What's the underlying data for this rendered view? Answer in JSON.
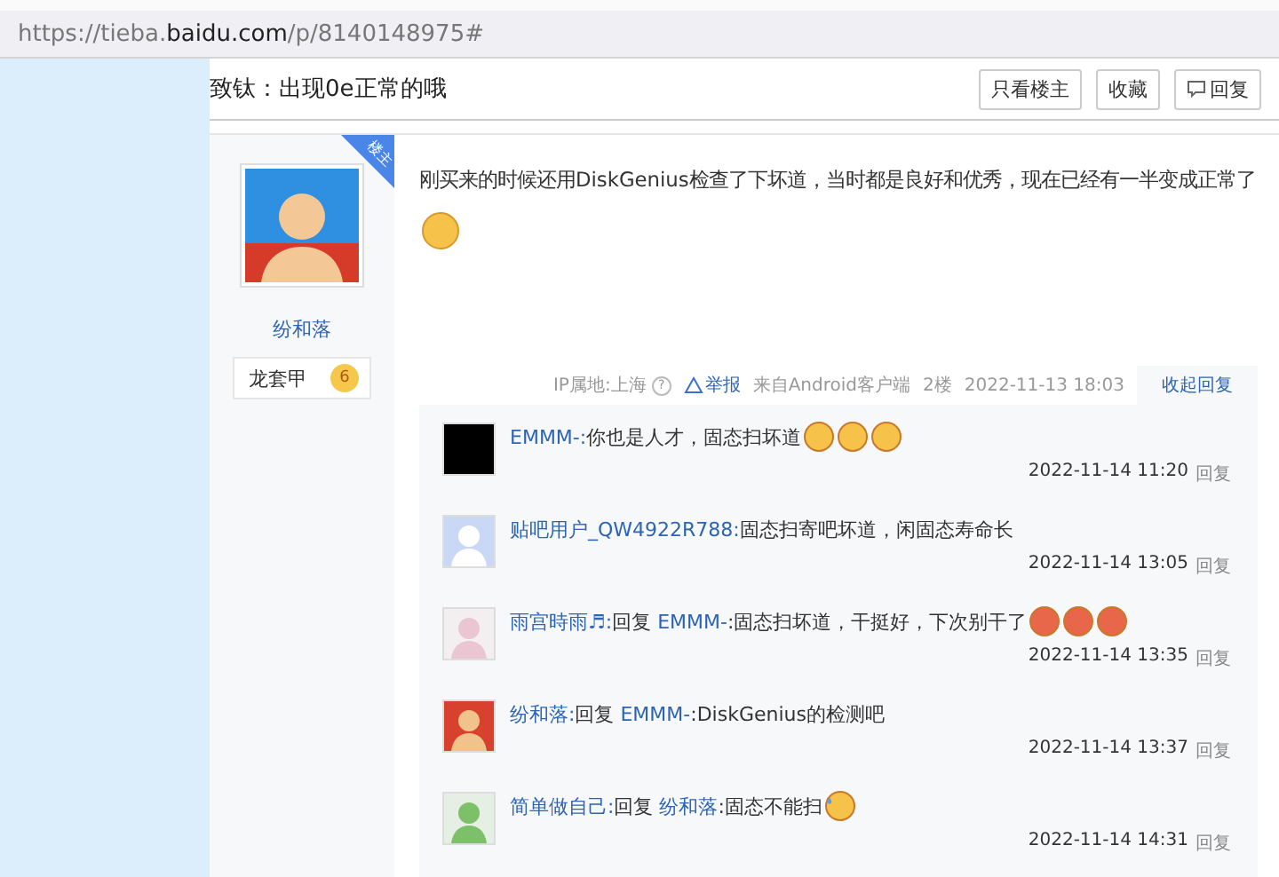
{
  "address_bar": {
    "url_prefix": "https://tieba.",
    "url_domain": "baidu.com",
    "url_path": "/p/8140148975#"
  },
  "thread": {
    "title": "致钛：出现0e正常的哦",
    "buttons": [
      {
        "label": "只看楼主",
        "kind": "plain"
      },
      {
        "label": "收藏",
        "kind": "plain"
      },
      {
        "label": "回复",
        "kind": "reply"
      }
    ]
  },
  "post": {
    "author": {
      "name": "纷和落",
      "badge": "楼主",
      "title": "龙套甲",
      "level": "6"
    },
    "content": {
      "text": "刚买来的时候还用DiskGenius检查了下坏道，当时都是良好和优秀，现在已经有一半变成正常了",
      "emoji": [
        {
          "kind": "smirk"
        }
      ]
    },
    "meta": {
      "ip": "IP属地:上海",
      "help": "?",
      "report": "举报",
      "source": "来自Android客户端",
      "floor": "2楼",
      "time": "2022-11-13 18:03",
      "collapse": "收起回复"
    },
    "replies": [
      {
        "avatar": {
          "kind": "black"
        },
        "user": "EMMM-:",
        "text": "你也是人才，固态扫坏道",
        "emoji": [
          {
            "kind": "smirk"
          },
          {
            "kind": "smirk"
          },
          {
            "kind": "smirk"
          }
        ],
        "time": "2022-11-14 11:20",
        "action": "回复"
      },
      {
        "avatar": {
          "kind": "default"
        },
        "user": "贴吧用户_QW4922R788:",
        "text": "固态扫寄吧坏道，闲固态寿命长",
        "time": "2022-11-14 13:05",
        "action": "回复"
      },
      {
        "avatar": {
          "kind": "pink"
        },
        "user": "雨宫時雨♬:",
        "reply_word": "回复",
        "reply_to": "EMMM-",
        "text": ":固态扫坏道，干挺好，下次别干了",
        "emoji": [
          {
            "kind": "red"
          },
          {
            "kind": "red"
          },
          {
            "kind": "red"
          }
        ],
        "time": "2022-11-14 13:35",
        "action": "回复"
      },
      {
        "avatar": {
          "kind": "red"
        },
        "user": "纷和落:",
        "reply_word": "回复",
        "reply_to": "EMMM-",
        "text": ":DiskGenius的检测吧",
        "time": "2022-11-14 13:37",
        "action": "回复"
      },
      {
        "avatar": {
          "kind": "green"
        },
        "user": "简单做自己:",
        "reply_word": "回复",
        "reply_to": "纷和落",
        "text": ":固态不能扫",
        "emoji": [
          {
            "kind": "sweat"
          }
        ],
        "time": "2022-11-14 14:31",
        "action": "回复"
      }
    ]
  }
}
